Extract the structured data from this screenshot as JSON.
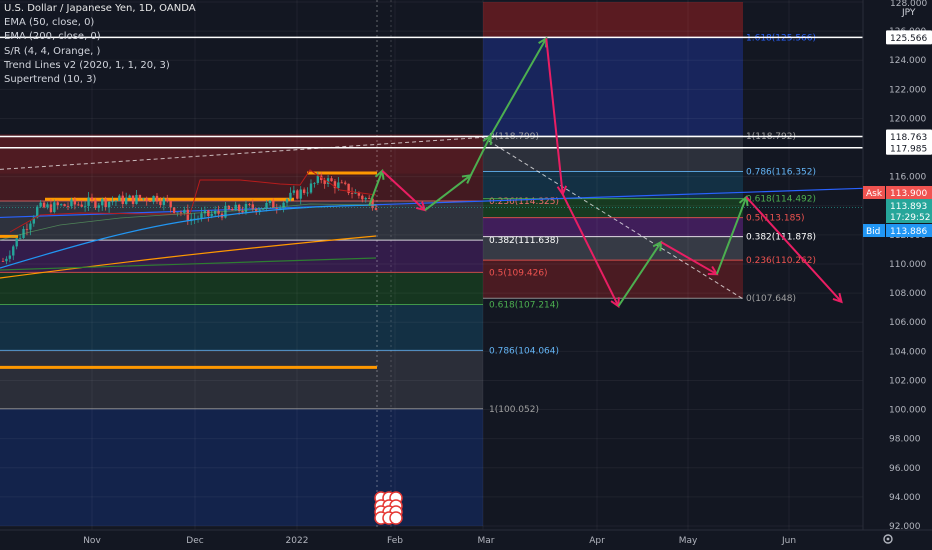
{
  "chart_data": {
    "type": "candlestick",
    "symbol_title": "U.S. Dollar / Japanese Yen, 1D, OANDA",
    "indicators": [
      "EMA (50, close, 0)",
      "EMA (200, close, 0)",
      "S/R (4, 4, Orange, )",
      "Trend Lines v2 (2020, 1, 1, 20, 3)",
      "Supertrend (10, 3)"
    ],
    "currency": "JPY",
    "ylim": [
      92,
      128
    ],
    "y_ticks": [
      "128.000",
      "126.000",
      "124.000",
      "122.000",
      "120.000",
      "118.000",
      "116.000",
      "114.000",
      "112.000",
      "110.000",
      "108.000",
      "106.000",
      "104.000",
      "102.000",
      "100.000",
      "98.000",
      "96.000",
      "94.000",
      "92.000"
    ],
    "x_ticks": [
      "Nov",
      "Dec",
      "2022",
      "Feb",
      "Mar",
      "Apr",
      "May",
      "Jun"
    ],
    "price_badges": [
      {
        "label": "125.566",
        "value": 125.566,
        "style": "white"
      },
      {
        "label": "118.763",
        "value": 118.763,
        "style": "white"
      },
      {
        "label": "117.985",
        "value": 117.985,
        "style": "white"
      },
      {
        "label": "Ask",
        "price": "113.900",
        "value": 113.9,
        "style": "red"
      },
      {
        "label": "",
        "price": "113.893",
        "time": "17:29:52",
        "value": 113.893,
        "style": "teal"
      },
      {
        "label": "Bid",
        "price": "113.886",
        "value": 113.886,
        "style": "blue"
      }
    ],
    "fib_left": [
      {
        "label": "0.236(114.325)",
        "value": 114.325,
        "color": "#ef6c6c"
      },
      {
        "label": "0.382(111.638)",
        "value": 111.638,
        "color": "#ffffff"
      },
      {
        "label": "0.5(109.426)",
        "value": 109.426,
        "color": "#ef5350"
      },
      {
        "label": "0.618(107.214)",
        "value": 107.214,
        "color": "#4caf50"
      },
      {
        "label": "0.786(104.064)",
        "value": 104.064,
        "color": "#64b5f6"
      },
      {
        "label": "1(100.052)",
        "value": 100.052,
        "color": "#a0a0a0"
      }
    ],
    "fib_right": [
      {
        "label": "1.618(125.566)",
        "value": 125.566,
        "color": "#2962ff"
      },
      {
        "label": "1(118.792)",
        "value": 118.792,
        "color": "#a0a0a0"
      },
      {
        "label": "0.786(116.352)",
        "value": 116.352,
        "color": "#64b5f6"
      },
      {
        "label": "0.618(114.492)",
        "value": 114.492,
        "color": "#4caf50"
      },
      {
        "label": "0.5(113.185)",
        "value": 113.185,
        "color": "#ef5350"
      },
      {
        "label": "0.382(111.878)",
        "value": 111.878,
        "color": "#ffffff"
      },
      {
        "label": "0.236(110.262)",
        "value": 110.262,
        "color": "#ef5350"
      },
      {
        "label": "0(107.648)",
        "value": 107.648,
        "color": "#a0a0a0"
      }
    ],
    "fib_top_left": {
      "label": "0(118.799)",
      "value": 118.799
    },
    "sr_levels": [
      {
        "value": 116.25,
        "from": "Dec",
        "to": "Feb"
      },
      {
        "value": 114.45,
        "from": "Oct",
        "to": "2022"
      },
      {
        "value": 102.9,
        "from": "Oct",
        "to": "Feb"
      },
      {
        "value": 111.4,
        "from": "Oct",
        "to": "Oct"
      }
    ],
    "horizontal_lines": [
      125.566,
      118.763,
      117.985
    ],
    "colors": {
      "background": "#131722",
      "up": "#26a69a",
      "down": "#ef5350",
      "sr": "#ff9800",
      "ema50": "#2196f3",
      "ema200": "#ff9800",
      "trend": "#2962ff",
      "projection_up": "#4caf50",
      "projection_down": "#e91e63"
    },
    "projection_path": [
      {
        "x": "2022-01-23",
        "y": 114.0
      },
      {
        "x": "2022-01-27",
        "y": 116.4
      },
      {
        "x": "2022-02-09",
        "y": 113.7
      },
      {
        "x": "2022-02-23",
        "y": 116.1
      },
      {
        "x": "2022-03-01",
        "y": 118.8
      },
      {
        "x": "2022-03-18",
        "y": 125.5
      },
      {
        "x": "2022-03-23",
        "y": 114.8
      },
      {
        "x": "2022-04-09",
        "y": 107.1
      },
      {
        "x": "2022-04-22",
        "y": 111.5
      },
      {
        "x": "2022-05-09",
        "y": 109.3
      },
      {
        "x": "2022-05-18",
        "y": 114.6
      },
      {
        "x": "2022-06-16",
        "y": 107.4
      }
    ]
  }
}
